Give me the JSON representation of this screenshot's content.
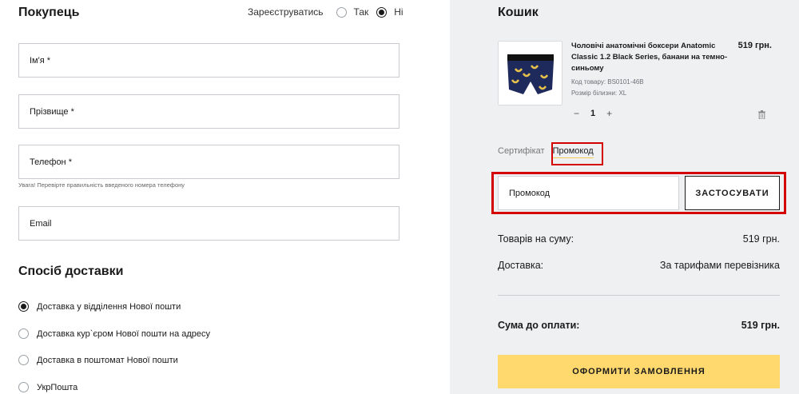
{
  "buyer": {
    "title": "Покупець",
    "register_label": "Зареєструватись",
    "register_yes": "Так",
    "register_no": "Ні",
    "register_selected": "no",
    "fields": {
      "name": "Ім'я *",
      "surname": "Прізвище *",
      "phone": "Телефон *",
      "phone_hint": "Увага! Перевірте правильність введеного номера телефону",
      "email": "Email"
    }
  },
  "delivery": {
    "title": "Спосіб доставки",
    "options": [
      "Доставка у відділення Нової пошти",
      "Доставка кур`єром Нової пошти на адресу",
      "Доставка в поштомат Нової пошти",
      "УкрПошта"
    ],
    "selected_index": 0
  },
  "cart": {
    "title": "Кошик",
    "item": {
      "name": "Чоловічі анатомічні боксери Anatomic Classic 1.2 Black Series, банани на темно-синьому",
      "price": "519 грн.",
      "code": "Код товару: BS0101-46B",
      "size": "Розмір білизни: XL",
      "qty_minus": "−",
      "qty": "1",
      "qty_plus": "+"
    },
    "tabs": {
      "certificate": "Сертифікат",
      "promo": "Промокод"
    },
    "promo_placeholder": "Промокод",
    "apply_label": "ЗАСТОСУВАТИ",
    "summary": {
      "goods_label": "Товарів на суму:",
      "goods_value": "519 грн.",
      "delivery_label": "Доставка:",
      "delivery_value": "За тарифами перевізника",
      "total_label": "Сума до оплати:",
      "total_value": "519 грн."
    },
    "order_label": "ОФОРМИТИ ЗАМОВЛЕННЯ"
  },
  "colors": {
    "accent": "#ffd86e",
    "highlight": "#d40000",
    "cart_bg": "#eef0f2"
  }
}
